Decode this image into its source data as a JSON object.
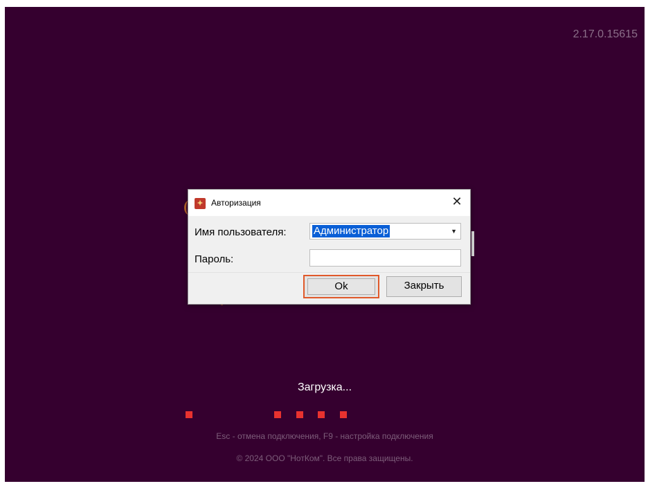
{
  "splash": {
    "version": "2.17.0.15615",
    "loading_text": "Загрузка...",
    "hint_text": "Esc - отмена подключения, F9 - настройка подключения",
    "copyright_text": "© 2024 ООО \"НотКом\". Все права защищены.",
    "background_color": "#35002f",
    "dot_color": "#e8322f"
  },
  "dialog": {
    "title": "Авторизация",
    "app_icon": "app-logo-icon",
    "close_icon": "close-icon",
    "username_label": "Имя пользователя:",
    "username_value": "Администратор",
    "password_label": "Пароль:",
    "password_value": "",
    "ok_label": "Ok",
    "close_label": "Закрыть",
    "focus_color": "#e0592a",
    "selection_color": "#0a5fd6"
  }
}
